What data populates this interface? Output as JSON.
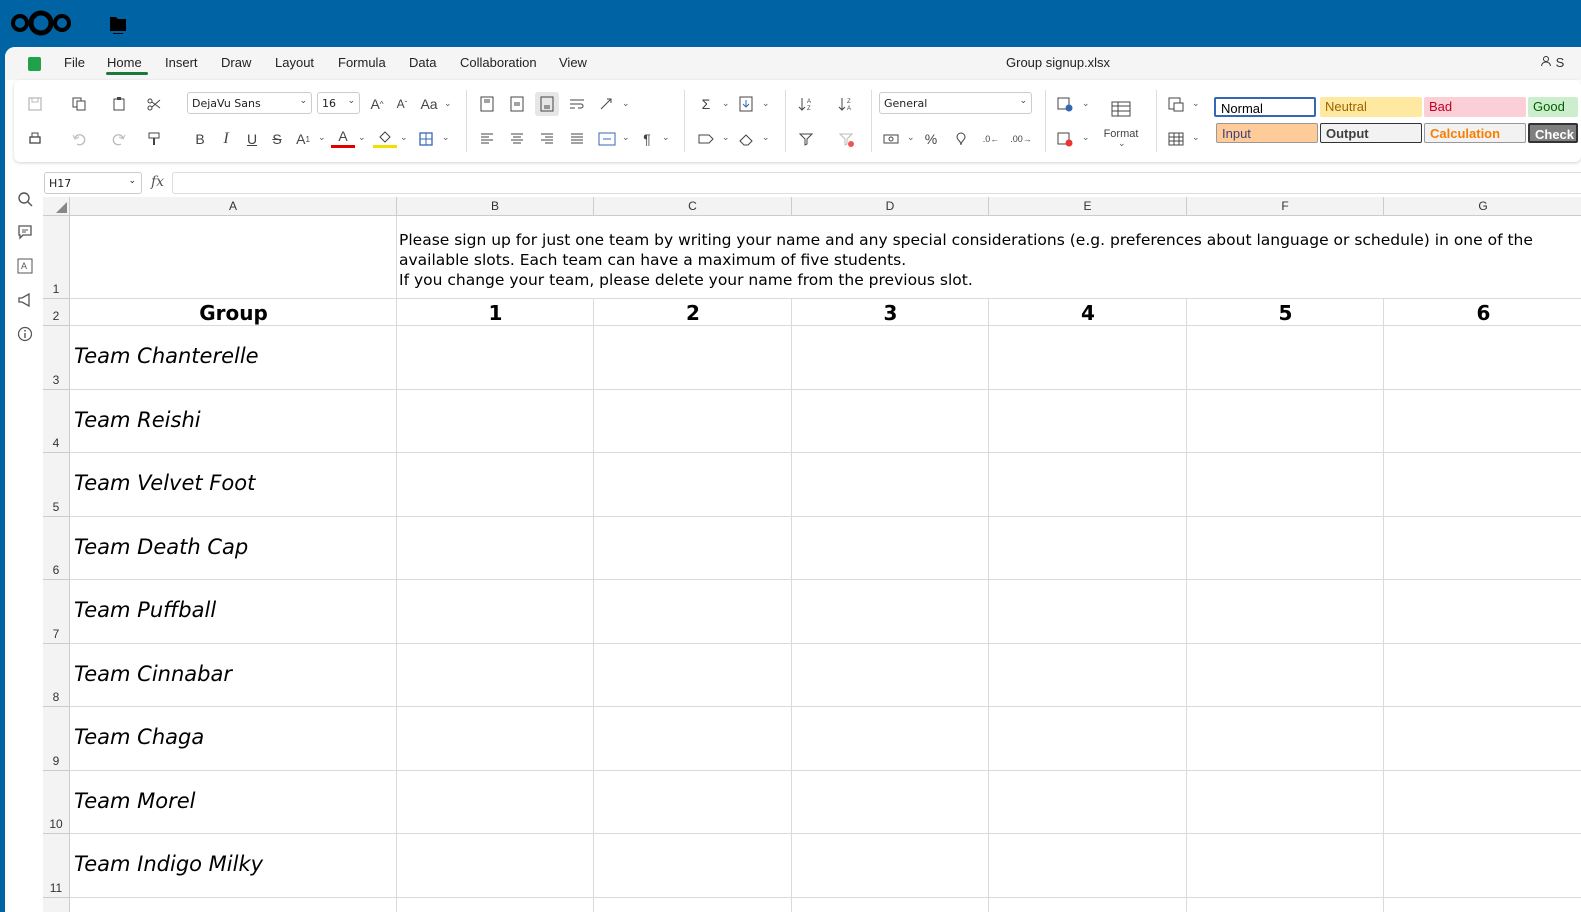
{
  "topbar": {
    "logo": "nextcloud-logo",
    "files_icon": "folder-icon"
  },
  "menubar": {
    "items": [
      "File",
      "Home",
      "Insert",
      "Draw",
      "Layout",
      "Formula",
      "Data",
      "Collaboration",
      "View"
    ],
    "active": "Home",
    "document_title": "Group signup.xlsx",
    "share_label": "S"
  },
  "ribbon": {
    "font_name": "DejaVu Sans",
    "font_size": "16",
    "number_format": "General",
    "format_label": "Format",
    "styles": [
      "Normal",
      "Neutral",
      "Bad",
      "Good",
      "Input",
      "Output",
      "Calculation",
      "Check"
    ]
  },
  "formula_bar": {
    "cell_ref": "H17",
    "fx": "fx",
    "formula": ""
  },
  "sheet": {
    "columns": [
      "A",
      "B",
      "C",
      "D",
      "E",
      "F",
      "G"
    ],
    "rows": [
      "1",
      "2",
      "3",
      "4",
      "5",
      "6",
      "7",
      "8",
      "9",
      "10",
      "11"
    ],
    "instructions": [
      "Please sign up for just one team by writing your name and any special considerations (e.g. preferences about language or schedule) in one of the",
      "available slots. Each team can have a maximum of five students.",
      "If you change your team, please delete your name from the previous slot."
    ],
    "header_row": [
      "Group",
      "1",
      "2",
      "3",
      "4",
      "5",
      "6"
    ],
    "teams": [
      "Team Chanterelle",
      "Team Reishi",
      "Team Velvet Foot",
      "Team Death Cap",
      "Team Puffball",
      "Team Cinnabar",
      "Team Chaga",
      "Team Morel",
      "Team Indigo Milky"
    ]
  }
}
